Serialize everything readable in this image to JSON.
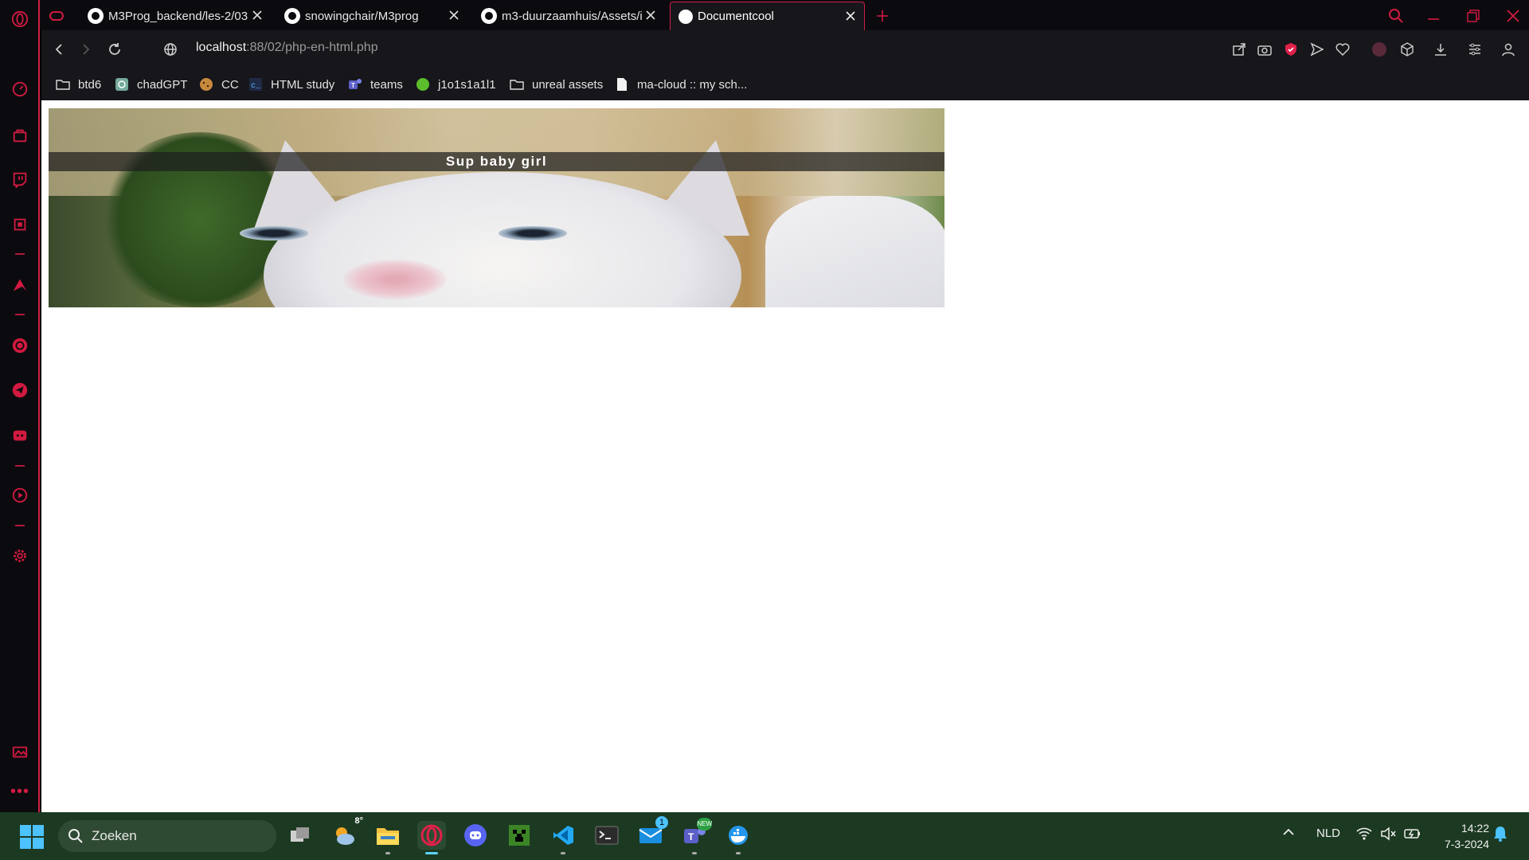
{
  "tabs": [
    {
      "title": "M3Prog_backend/les-2/03",
      "active": false
    },
    {
      "title": "snowingchair/M3prog",
      "active": false
    },
    {
      "title": "m3-duurzaamhuis/Assets/i",
      "active": false
    },
    {
      "title": "Documentcool",
      "active": true
    }
  ],
  "address": {
    "host": "localhost",
    "path": ":88/02/php-en-html.php"
  },
  "bookmarks": [
    "btd6",
    "chadGPT",
    "CC",
    "HTML study",
    "teams",
    "j1o1s1a1l1",
    "unreal assets",
    "ma-cloud :: my sch..."
  ],
  "page": {
    "image_caption": "Sup baby girl"
  },
  "taskbar": {
    "search_placeholder": "Zoeken",
    "weather_temp": "8°",
    "mail_badge": "1",
    "teams_badge": "NEW",
    "language": "NLD",
    "time": "14:22",
    "date": "7-3-2024"
  },
  "colors": {
    "accent": "#cf1e44",
    "chrome_bg": "#16161b",
    "taskbar_bg": "#1c3a22"
  }
}
